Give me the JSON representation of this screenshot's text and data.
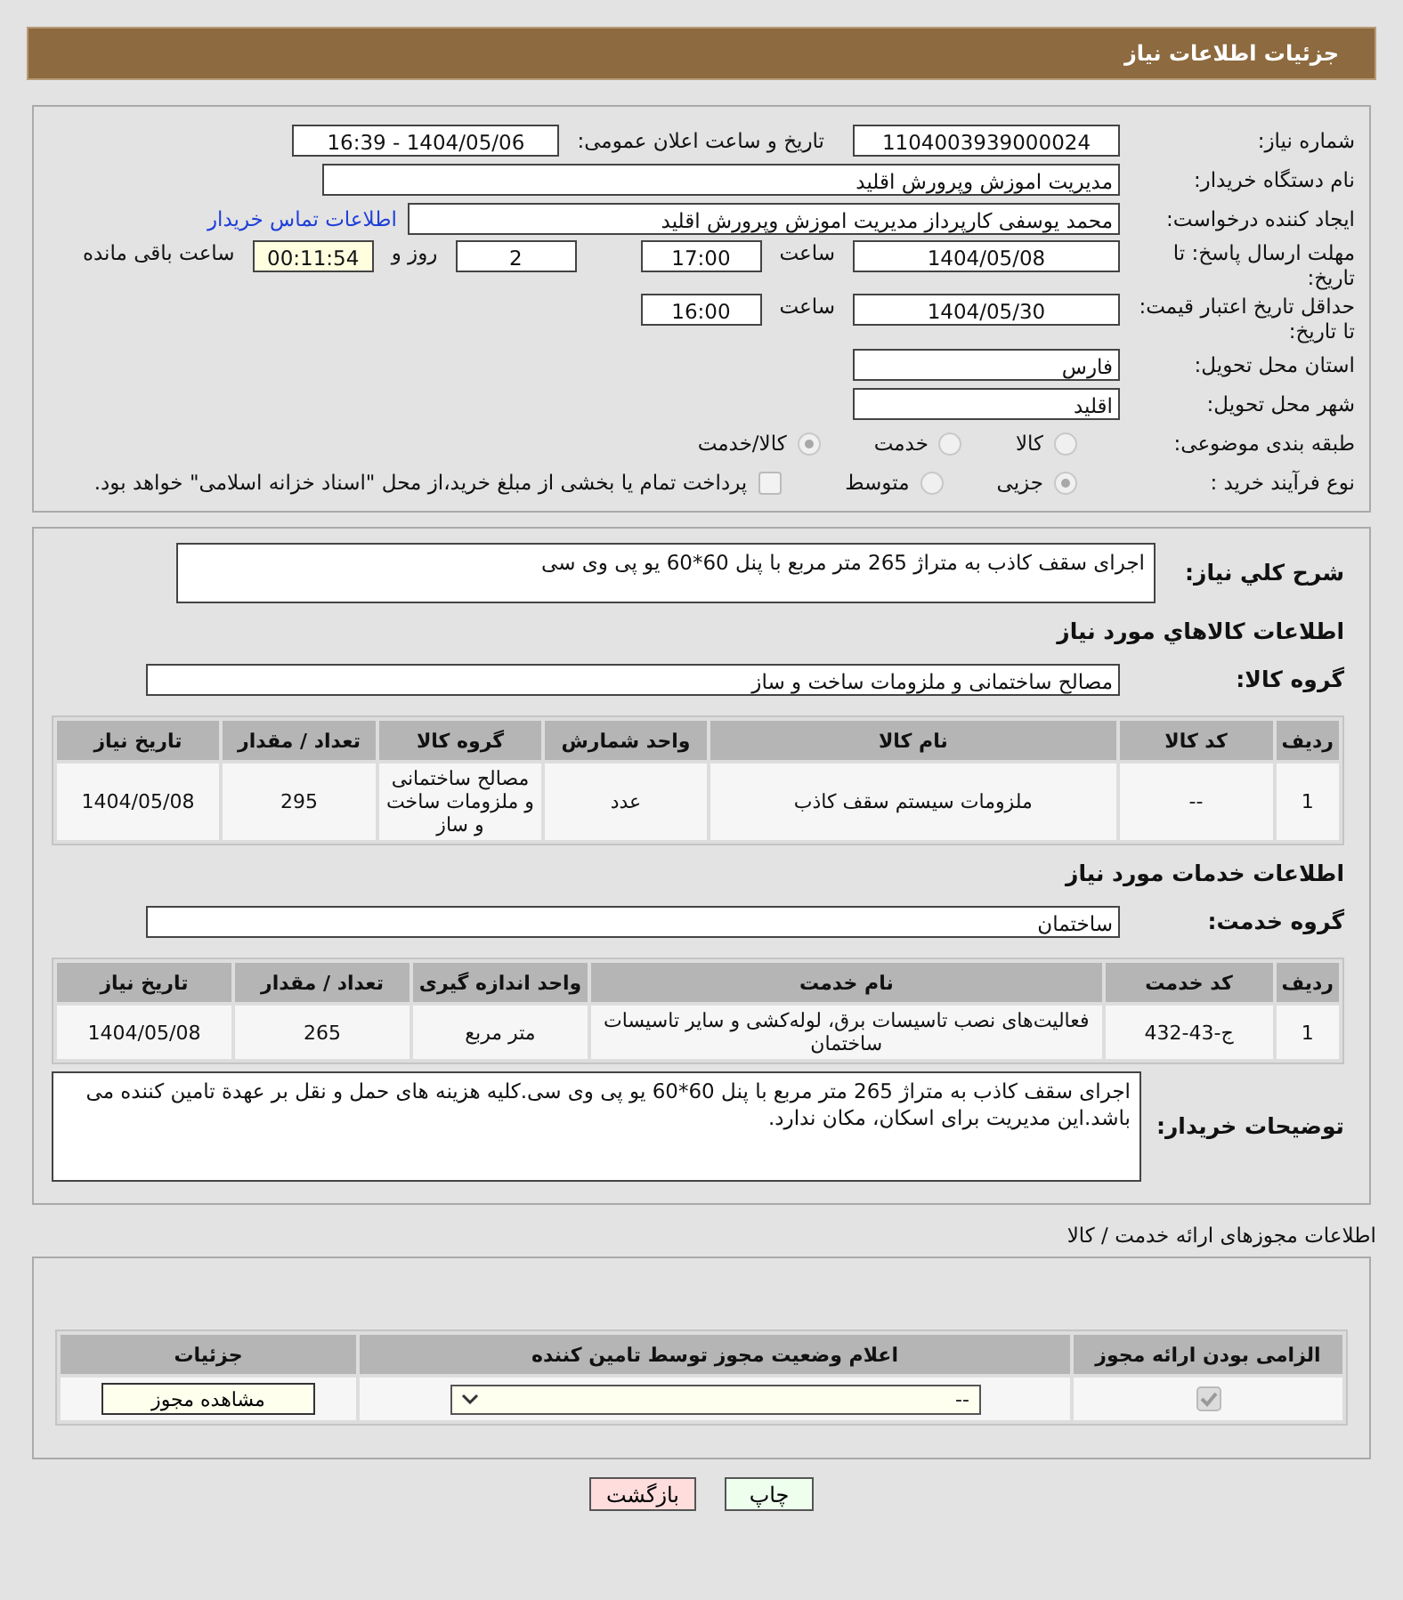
{
  "header": {
    "title": "جزئیات اطلاعات نیاز"
  },
  "form": {
    "need_number": {
      "label": "شماره نیاز:",
      "value": "1104003939000024"
    },
    "announce": {
      "label": "تاریخ و ساعت اعلان عمومی:",
      "value": "1404/05/06 - 16:39"
    },
    "buyer_org": {
      "label": "نام دستگاه خریدار:",
      "value": "مدیریت اموزش وپرورش اقلید"
    },
    "requester": {
      "label": "ایجاد کننده درخواست:",
      "value": "محمد یوسفی کارپرداز مدیریت اموزش وپرورش اقلید",
      "link": "اطلاعات تماس خریدار"
    },
    "deadline": {
      "label": "مهلت ارسال پاسخ: تا تاریخ:",
      "date": "1404/05/08",
      "time_label": "ساعت",
      "time": "17:00",
      "days": "2",
      "days_label": "روز و",
      "remaining": "00:11:54",
      "remaining_label": "ساعت باقی مانده"
    },
    "validity": {
      "label": "حداقل تاریخ اعتبار قیمت: تا تاریخ:",
      "date": "1404/05/30",
      "time_label": "ساعت",
      "time": "16:00"
    },
    "province": {
      "label": "استان محل تحویل:",
      "value": "فارس"
    },
    "city": {
      "label": "شهر محل تحویل:",
      "value": "اقلید"
    },
    "category": {
      "label": "طبقه بندی موضوعی:",
      "options": [
        {
          "label": "کالا",
          "selected": false
        },
        {
          "label": "خدمت",
          "selected": false
        },
        {
          "label": "کالا/خدمت",
          "selected": true
        }
      ]
    },
    "purchase": {
      "label": "نوع فرآیند خرید :",
      "options": [
        {
          "label": "جزیی",
          "selected": true
        },
        {
          "label": "متوسط",
          "selected": false
        }
      ],
      "treasury": {
        "label": "پرداخت تمام یا بخشی از مبلغ خرید،از محل \"اسناد خزانه اسلامی\" خواهد بود.",
        "checked": false
      }
    }
  },
  "description": {
    "label": "شرح کلي نیاز:",
    "value": "اجرای سقف کاذب به متراژ 265 متر مربع با پنل 60*60 یو پی وی سی"
  },
  "goods": {
    "heading": "اطلاعات کالاهاي مورد نیاز",
    "group": {
      "label": "گروه کالا:",
      "value": "مصالح ساختمانی و ملزومات ساخت و ساز"
    },
    "columns": [
      "ردیف",
      "کد کالا",
      "نام کالا",
      "واحد شمارش",
      "گروه کالا",
      "تعداد / مقدار",
      "تاریخ نیاز"
    ],
    "rows": [
      [
        "1",
        "--",
        "ملزومات سیستم سقف کاذب",
        "عدد",
        "مصالح ساختمانی و ملزومات ساخت و ساز",
        "295",
        "1404/05/08"
      ]
    ]
  },
  "services": {
    "heading": "اطلاعات خدمات مورد نیاز",
    "group": {
      "label": "گروه خدمت:",
      "value": "ساختمان"
    },
    "columns": [
      "ردیف",
      "کد خدمت",
      "نام خدمت",
      "واحد اندازه گیری",
      "تعداد / مقدار",
      "تاریخ نیاز"
    ],
    "rows": [
      [
        "1",
        "ج-43-432",
        "فعالیت‌های نصب تاسیسات برق، لوله‌کشی و سایر تاسیسات ساختمان",
        "متر مربع",
        "265",
        "1404/05/08"
      ]
    ]
  },
  "buyer_notes": {
    "label": "توضیحات خریدار:",
    "value": "اجرای سقف کاذب به متراژ 265 متر مربع با پنل 60*60 یو پی وی سی.کلیه هزینه های حمل و نقل بر عهدة تامین کننده می باشد.این مدیریت برای اسکان، مکان ندارد."
  },
  "licenses": {
    "heading": "اطلاعات مجوزهای ارائه خدمت / کالا",
    "columns": [
      "الزامی بودن ارائه مجوز",
      "اعلام وضعیت مجوز توسط تامین کننده",
      "جزئیات"
    ],
    "rows": [
      {
        "required": true,
        "status": "--",
        "details_button": "مشاهده مجوز"
      }
    ]
  },
  "buttons": [
    {
      "label": "چاپ",
      "kind": "print"
    },
    {
      "label": "بازگشت",
      "kind": "back"
    }
  ]
}
